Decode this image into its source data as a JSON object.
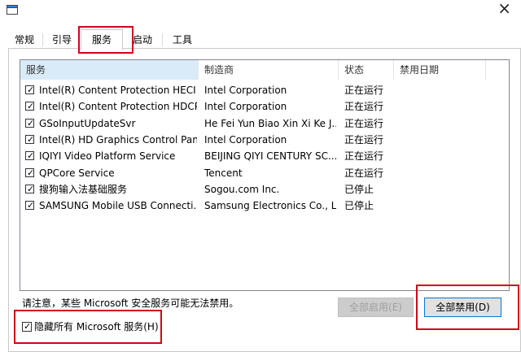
{
  "window": {
    "icon": "window-icon",
    "close_glyph": "×"
  },
  "tabs": [
    {
      "label": "常规",
      "active": false
    },
    {
      "label": "引导",
      "active": false
    },
    {
      "label": "服务",
      "active": true
    },
    {
      "label": "启动",
      "active": false
    },
    {
      "label": "工具",
      "active": false
    }
  ],
  "table": {
    "columns": [
      "服务",
      "制造商",
      "状态",
      "禁用日期"
    ],
    "rows": [
      {
        "checked": true,
        "service": "Intel(R) Content Protection HECI ...",
        "maker": "Intel Corporation",
        "status": "正在运行",
        "date": ""
      },
      {
        "checked": true,
        "service": "Intel(R) Content Protection HDCP...",
        "maker": "Intel Corporation",
        "status": "正在运行",
        "date": ""
      },
      {
        "checked": true,
        "service": "GSoInputUpdateSvr",
        "maker": "He Fei Yun Biao Xin Xi Ke J...",
        "status": "正在运行",
        "date": ""
      },
      {
        "checked": true,
        "service": "Intel(R) HD Graphics Control Pan...",
        "maker": "Intel Corporation",
        "status": "正在运行",
        "date": ""
      },
      {
        "checked": true,
        "service": "IQIYI Video Platform Service",
        "maker": "BEIJING QIYI CENTURY SC...",
        "status": "正在运行",
        "date": ""
      },
      {
        "checked": true,
        "service": "QPCore Service",
        "maker": "Tencent",
        "status": "正在运行",
        "date": ""
      },
      {
        "checked": true,
        "service": "搜狗输入法基础服务",
        "maker": "Sogou.com Inc.",
        "status": "已停止",
        "date": ""
      },
      {
        "checked": true,
        "service": "SAMSUNG Mobile USB Connecti...",
        "maker": "Samsung Electronics Co., L...",
        "status": "已停止",
        "date": ""
      }
    ]
  },
  "notice": "请注意，某些 Microsoft 安全服务可能无法禁用。",
  "buttons": {
    "enable_all": "全部启用(E)",
    "disable_all": "全部禁用(D)"
  },
  "hide_ms": {
    "checked": true,
    "label": "隐藏所有 Microsoft 服务(H)"
  },
  "colors": {
    "highlight": "#d0021b",
    "header_sorted": "#d9ebf9",
    "primary_border": "#0078d7"
  }
}
